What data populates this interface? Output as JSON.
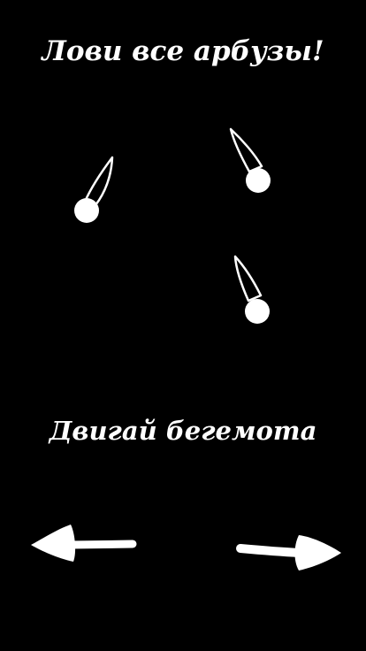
{
  "game": {
    "title": "Лови все арбузы!",
    "instruction": "Двигай бегемота"
  },
  "falling_objects": [
    {
      "name": "watermelon-1",
      "icon": "falling-watermelon-icon"
    },
    {
      "name": "watermelon-2",
      "icon": "falling-watermelon-icon"
    },
    {
      "name": "watermelon-3",
      "icon": "falling-watermelon-icon"
    }
  ],
  "controls": {
    "left_icon": "arrow-left-icon",
    "right_icon": "arrow-right-icon"
  },
  "colors": {
    "background": "#000000",
    "foreground": "#ffffff"
  }
}
